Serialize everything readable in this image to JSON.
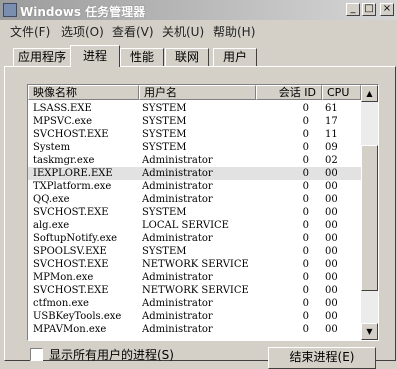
{
  "window": {
    "title": "Windows 任务管理器",
    "minimize": "_",
    "maximize": "□",
    "close": "×"
  },
  "menu": [
    "文件(F)",
    "选项(O)",
    "查看(V)",
    "关机(U)",
    "帮助(H)"
  ],
  "tabs": [
    "应用程序",
    "进程",
    "性能",
    "联网",
    "用户"
  ],
  "active_tab": "进程",
  "columns": {
    "image_name": "映像名称",
    "user_name": "用户名",
    "session_id": "会话 ID",
    "cpu": "CPU"
  },
  "processes": [
    {
      "name": "LSASS.EXE",
      "user": "SYSTEM",
      "session": "0",
      "cpu": "61"
    },
    {
      "name": "MPSVC.exe",
      "user": "SYSTEM",
      "session": "0",
      "cpu": "17"
    },
    {
      "name": "SVCHOST.EXE",
      "user": "SYSTEM",
      "session": "0",
      "cpu": "11"
    },
    {
      "name": "System",
      "user": "SYSTEM",
      "session": "0",
      "cpu": "09"
    },
    {
      "name": "taskmgr.exe",
      "user": "Administrator",
      "session": "0",
      "cpu": "02"
    },
    {
      "name": "IEXPLORE.EXE",
      "user": "Administrator",
      "session": "0",
      "cpu": "00"
    },
    {
      "name": "TXPlatform.exe",
      "user": "Administrator",
      "session": "0",
      "cpu": "00"
    },
    {
      "name": "QQ.exe",
      "user": "Administrator",
      "session": "0",
      "cpu": "00"
    },
    {
      "name": "SVCHOST.EXE",
      "user": "SYSTEM",
      "session": "0",
      "cpu": "00"
    },
    {
      "name": "alg.exe",
      "user": "LOCAL SERVICE",
      "session": "0",
      "cpu": "00"
    },
    {
      "name": "SoftupNotify.exe",
      "user": "Administrator",
      "session": "0",
      "cpu": "00"
    },
    {
      "name": "SPOOLSV.EXE",
      "user": "SYSTEM",
      "session": "0",
      "cpu": "00"
    },
    {
      "name": "SVCHOST.EXE",
      "user": "NETWORK SERVICE",
      "session": "0",
      "cpu": "00"
    },
    {
      "name": "MPMon.exe",
      "user": "Administrator",
      "session": "0",
      "cpu": "00"
    },
    {
      "name": "SVCHOST.EXE",
      "user": "NETWORK SERVICE",
      "session": "0",
      "cpu": "00"
    },
    {
      "name": "ctfmon.exe",
      "user": "Administrator",
      "session": "0",
      "cpu": "00"
    },
    {
      "name": "USBKeyTools.exe",
      "user": "Administrator",
      "session": "0",
      "cpu": "00"
    },
    {
      "name": "MPAVMon.exe",
      "user": "Administrator",
      "session": "0",
      "cpu": "00"
    }
  ],
  "selected_row": 5,
  "show_all_users_label": "显示所有用户的进程(S)",
  "end_process_label": "结束进程(E)"
}
